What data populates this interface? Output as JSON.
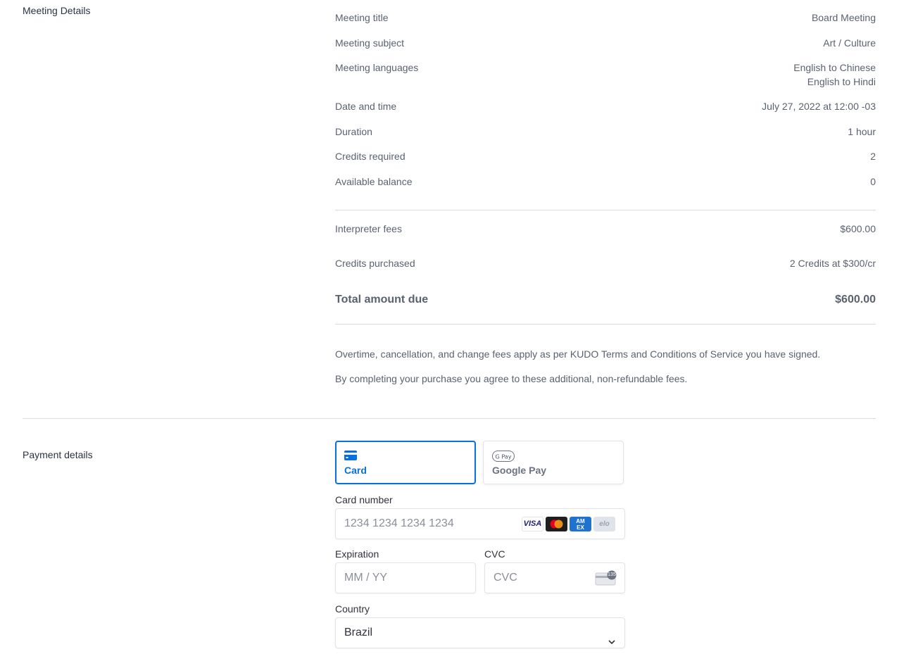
{
  "meeting": {
    "section_label": "Meeting Details",
    "rows": [
      {
        "label": "Meeting title",
        "value": "Board Meeting"
      },
      {
        "label": "Meeting subject",
        "value": "Art / Culture"
      },
      {
        "label": "Meeting languages",
        "values": [
          "English to Chinese",
          "English to Hindi"
        ]
      },
      {
        "label": "Date and time",
        "value": "July 27, 2022 at 12:00 -03"
      },
      {
        "label": "Duration",
        "value": "1 hour"
      },
      {
        "label": "Credits required",
        "value": "2"
      },
      {
        "label": "Available balance",
        "value": "0"
      }
    ],
    "fees": {
      "label": "Interpreter fees",
      "value": "$600.00"
    },
    "credits_purchased": {
      "label": "Credits purchased",
      "value": "2 Credits at $300/cr"
    },
    "total": {
      "label": "Total amount due",
      "value": "$600.00"
    },
    "notes": [
      "Overtime, cancellation, and change fees apply as per KUDO Terms and Conditions of Service you have signed.",
      "By completing your purchase you agree to these additional, non-refundable fees."
    ]
  },
  "payment": {
    "section_label": "Payment details",
    "tabs": [
      {
        "label": "Card",
        "icon": "card-icon",
        "active": true
      },
      {
        "label": "Google Pay",
        "icon": "google-pay-icon",
        "active": false
      }
    ],
    "card_number": {
      "label": "Card number",
      "placeholder": "1234 1234 1234 1234",
      "brands": [
        "VISA",
        "Mastercard",
        "AMEX",
        "Elo"
      ]
    },
    "expiration": {
      "label": "Expiration",
      "placeholder": "MM / YY"
    },
    "cvc": {
      "label": "CVC",
      "placeholder": "CVC",
      "icon_text": "135"
    },
    "country": {
      "label": "Country",
      "value": "Brazil"
    },
    "accent_color": "#0570de"
  }
}
